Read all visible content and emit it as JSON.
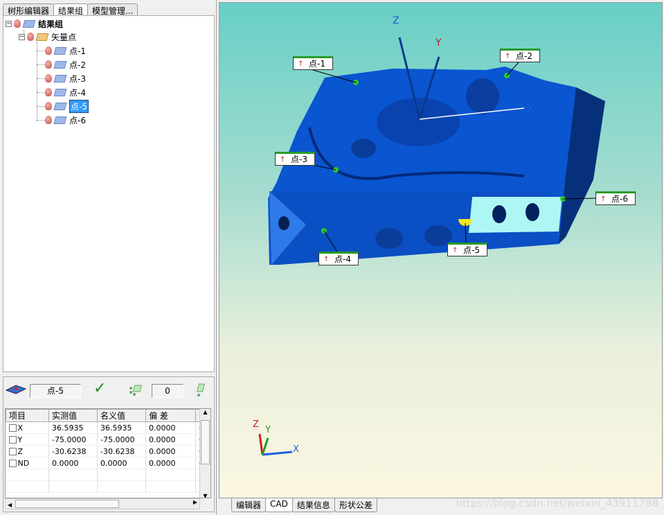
{
  "left_tabs": [
    "树形编辑器",
    "结果组",
    "模型管理..."
  ],
  "tree": {
    "root": "结果组",
    "group": "矢量点",
    "items": [
      "点-1",
      "点-2",
      "点-3",
      "点-4",
      "点-5",
      "点-6"
    ],
    "selected": "点-5"
  },
  "bottom": {
    "point_name": "点-5",
    "count": "0",
    "columns": [
      "项目",
      "实测值",
      "名义值",
      "偏 差",
      ""
    ],
    "rows": [
      [
        "X",
        "36.5935",
        "36.5935",
        "0.0000"
      ],
      [
        "Y",
        "-75.0000",
        "-75.0000",
        "0.0000"
      ],
      [
        "Z",
        "-30.6238",
        "-30.6238",
        "0.0000"
      ],
      [
        "ND",
        "0.0000",
        "0.0000",
        "0.0000"
      ]
    ]
  },
  "viewport": {
    "point_labels": [
      "点-1",
      "点-2",
      "点-3",
      "点-4",
      "点-5",
      "点-6"
    ],
    "axes": {
      "x": "X",
      "y": "Y",
      "z": "Z"
    },
    "model_color": "#0a55d0"
  },
  "view_tabs": [
    "编辑器",
    "CAD",
    "结果信息",
    "形状公差"
  ],
  "watermark": "https://blog.csdn.net/weixin_43911798"
}
